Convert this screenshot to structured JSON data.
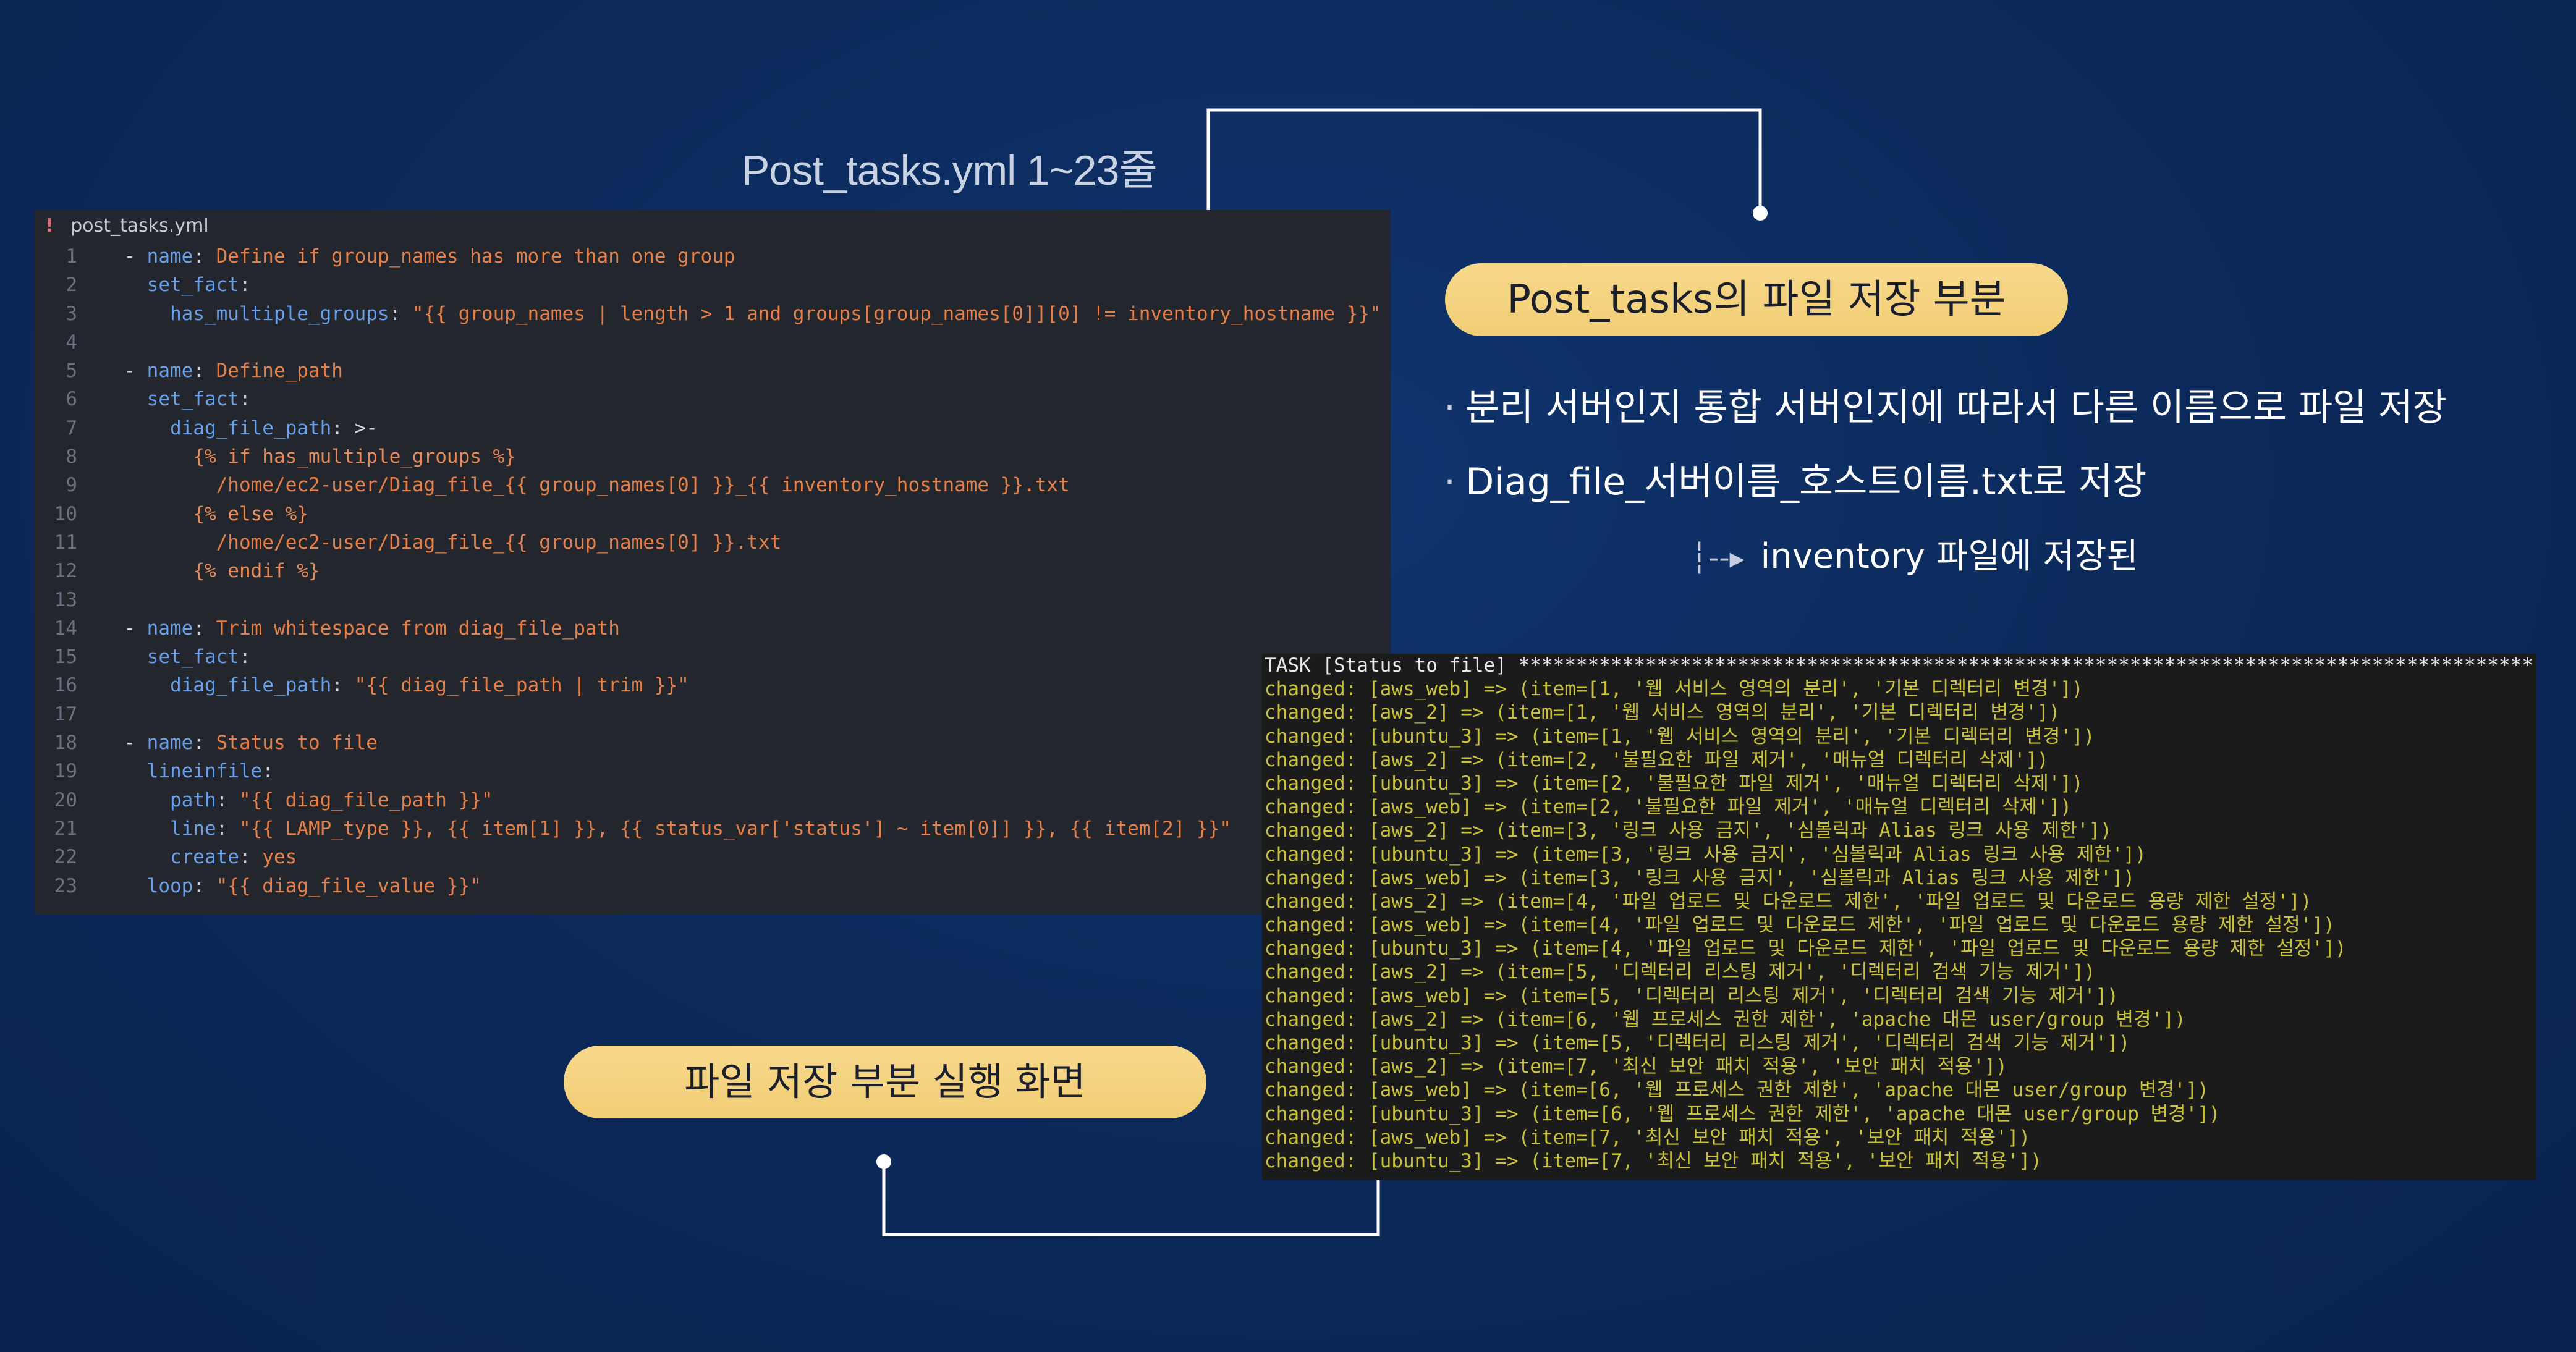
{
  "caption": "Post_tasks.yml 1~23줄",
  "editor": {
    "tab_name": "post_tasks.yml",
    "lines": [
      {
        "n": "1",
        "parts": [
          [
            "  ",
            "p"
          ],
          [
            "- ",
            "p"
          ],
          [
            "name",
            "key"
          ],
          [
            ": ",
            "p"
          ],
          [
            "Define if group_names has more than one group",
            "val"
          ]
        ]
      },
      {
        "n": "2",
        "parts": [
          [
            "    ",
            "p"
          ],
          [
            "set_fact",
            "key"
          ],
          [
            ":",
            "p"
          ]
        ]
      },
      {
        "n": "3",
        "parts": [
          [
            "      ",
            "p"
          ],
          [
            "has_multiple_groups",
            "key"
          ],
          [
            ": ",
            "p"
          ],
          [
            "\"{{ group_names | length > 1 and groups[group_names[0]][0] != inventory_hostname }}\"",
            "val"
          ]
        ]
      },
      {
        "n": "4",
        "parts": []
      },
      {
        "n": "5",
        "parts": [
          [
            "  ",
            "p"
          ],
          [
            "- ",
            "p"
          ],
          [
            "name",
            "key"
          ],
          [
            ": ",
            "p"
          ],
          [
            "Define_path",
            "val"
          ]
        ]
      },
      {
        "n": "6",
        "parts": [
          [
            "    ",
            "p"
          ],
          [
            "set_fact",
            "key"
          ],
          [
            ":",
            "p"
          ]
        ]
      },
      {
        "n": "7",
        "parts": [
          [
            "      ",
            "p"
          ],
          [
            "diag_file_path",
            "key"
          ],
          [
            ": >-",
            "p"
          ]
        ]
      },
      {
        "n": "8",
        "parts": [
          [
            "        ",
            "p"
          ],
          [
            "{% if has_multiple_groups %}",
            "tmpl"
          ]
        ]
      },
      {
        "n": "9",
        "parts": [
          [
            "          ",
            "p"
          ],
          [
            "/home/ec2-user/Diag_file_{{ group_names[0] }}_{{ inventory_hostname }}.txt",
            "val"
          ]
        ]
      },
      {
        "n": "10",
        "parts": [
          [
            "        ",
            "p"
          ],
          [
            "{% else %}",
            "tmpl"
          ]
        ]
      },
      {
        "n": "11",
        "parts": [
          [
            "          ",
            "p"
          ],
          [
            "/home/ec2-user/Diag_file_{{ group_names[0] }}.txt",
            "val"
          ]
        ]
      },
      {
        "n": "12",
        "parts": [
          [
            "        ",
            "p"
          ],
          [
            "{% endif %}",
            "tmpl"
          ]
        ]
      },
      {
        "n": "13",
        "parts": []
      },
      {
        "n": "14",
        "parts": [
          [
            "  ",
            "p"
          ],
          [
            "- ",
            "p"
          ],
          [
            "name",
            "key"
          ],
          [
            ": ",
            "p"
          ],
          [
            "Trim whitespace from diag_file_path",
            "val"
          ]
        ]
      },
      {
        "n": "15",
        "parts": [
          [
            "    ",
            "p"
          ],
          [
            "set_fact",
            "key"
          ],
          [
            ":",
            "p"
          ]
        ]
      },
      {
        "n": "16",
        "parts": [
          [
            "      ",
            "p"
          ],
          [
            "diag_file_path",
            "key"
          ],
          [
            ": ",
            "p"
          ],
          [
            "\"{{ diag_file_path | trim }}\"",
            "val"
          ]
        ]
      },
      {
        "n": "17",
        "parts": []
      },
      {
        "n": "18",
        "parts": [
          [
            "  ",
            "p"
          ],
          [
            "- ",
            "p"
          ],
          [
            "name",
            "key"
          ],
          [
            ": ",
            "p"
          ],
          [
            "Status to file",
            "val"
          ]
        ]
      },
      {
        "n": "19",
        "parts": [
          [
            "    ",
            "p"
          ],
          [
            "lineinfile",
            "key"
          ],
          [
            ":",
            "p"
          ]
        ]
      },
      {
        "n": "20",
        "parts": [
          [
            "      ",
            "p"
          ],
          [
            "path",
            "key"
          ],
          [
            ": ",
            "p"
          ],
          [
            "\"{{ diag_file_path }}\"",
            "val"
          ]
        ]
      },
      {
        "n": "21",
        "parts": [
          [
            "      ",
            "p"
          ],
          [
            "line",
            "key"
          ],
          [
            ": ",
            "p"
          ],
          [
            "\"{{ LAMP_type }}, {{ item[1] }}, {{ status_var['status'] ~ item[0]] }}, {{ item[2] }}\"",
            "val"
          ]
        ]
      },
      {
        "n": "22",
        "parts": [
          [
            "      ",
            "p"
          ],
          [
            "create",
            "key"
          ],
          [
            ": ",
            "p"
          ],
          [
            "yes",
            "val"
          ]
        ]
      },
      {
        "n": "23",
        "parts": [
          [
            "    ",
            "p"
          ],
          [
            "loop",
            "key"
          ],
          [
            ": ",
            "p"
          ],
          [
            "\"{{ diag_file_value }}\"",
            "val"
          ]
        ]
      }
    ]
  },
  "pill_top": "Post_tasks의 파일 저장 부분",
  "bullets": [
    "분리 서버인지 통합 서버인지에 따라서 다른 이름으로 파일 저장",
    "Diag_file_서버이름_호스트이름.txt로 저장"
  ],
  "subnote": "inventory 파일에 저장된",
  "pill_bottom": "파일 저장 부분 실행 화면",
  "terminal": {
    "header": "TASK [Status to file] ****************************************************************************************",
    "lines": [
      "changed: [aws_web] => (item=[1, '웹 서비스 영역의 분리', '기본 디렉터리 변경'])",
      "changed: [aws_2] => (item=[1, '웹 서비스 영역의 분리', '기본 디렉터리 변경'])",
      "changed: [ubuntu_3] => (item=[1, '웹 서비스 영역의 분리', '기본 디렉터리 변경'])",
      "changed: [aws_2] => (item=[2, '불필요한 파일 제거', '매뉴얼 디렉터리 삭제'])",
      "changed: [ubuntu_3] => (item=[2, '불필요한 파일 제거', '매뉴얼 디렉터리 삭제'])",
      "changed: [aws_web] => (item=[2, '불필요한 파일 제거', '매뉴얼 디렉터리 삭제'])",
      "changed: [aws_2] => (item=[3, '링크 사용 금지', '심볼릭과 Alias 링크 사용 제한'])",
      "changed: [ubuntu_3] => (item=[3, '링크 사용 금지', '심볼릭과 Alias 링크 사용 제한'])",
      "changed: [aws_web] => (item=[3, '링크 사용 금지', '심볼릭과 Alias 링크 사용 제한'])",
      "changed: [aws_2] => (item=[4, '파일 업로드 및 다운로드 제한', '파일 업로드 및 다운로드 용량 제한 설정'])",
      "changed: [aws_web] => (item=[4, '파일 업로드 및 다운로드 제한', '파일 업로드 및 다운로드 용량 제한 설정'])",
      "changed: [ubuntu_3] => (item=[4, '파일 업로드 및 다운로드 제한', '파일 업로드 및 다운로드 용량 제한 설정'])",
      "changed: [aws_2] => (item=[5, '디렉터리 리스팅 제거', '디렉터리 검색 기능 제거'])",
      "changed: [aws_web] => (item=[5, '디렉터리 리스팅 제거', '디렉터리 검색 기능 제거'])",
      "changed: [aws_2] => (item=[6, '웹 프로세스 권한 제한', 'apache 대몬 user/group 변경'])",
      "changed: [ubuntu_3] => (item=[5, '디렉터리 리스팅 제거', '디렉터리 검색 기능 제거'])",
      "changed: [aws_2] => (item=[7, '최신 보안 패치 적용', '보안 패치 적용'])",
      "changed: [aws_web] => (item=[6, '웹 프로세스 권한 제한', 'apache 대몬 user/group 변경'])",
      "changed: [ubuntu_3] => (item=[6, '웹 프로세스 권한 제한', 'apache 대몬 user/group 변경'])",
      "changed: [aws_web] => (item=[7, '최신 보안 패치 적용', '보안 패치 적용'])",
      "changed: [ubuntu_3] => (item=[7, '최신 보안 패치 적용', '보안 패치 적용'])"
    ]
  },
  "colors": {
    "background": "#0c2a5c",
    "pill": "#f3d27b",
    "code_key": "#6aa0ea",
    "code_value": "#e5804a",
    "terminal_text": "#c9c23a"
  }
}
